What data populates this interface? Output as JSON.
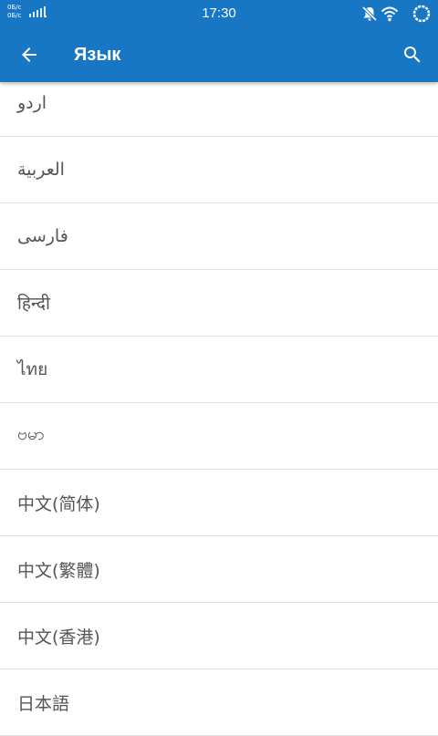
{
  "status_bar": {
    "data_rate_1": "0Б/с",
    "data_rate_2": "0Б/с",
    "time": "17:30",
    "icons": [
      "signal-icon",
      "mute-icon",
      "wifi-icon",
      "sync-icon"
    ]
  },
  "app_bar": {
    "title": "Язык",
    "back_icon": "arrow-back-icon",
    "search_icon": "search-icon"
  },
  "languages": [
    "اردو",
    "العربية",
    "فارسی",
    "हिन्दी",
    "ไทย",
    "ဗမာ",
    "中文(简体)",
    "中文(繁體)",
    "中文(香港)",
    "日本語"
  ],
  "colors": {
    "primary": "#1877c4",
    "text": "#555555",
    "divider": "#e2e2e2"
  }
}
